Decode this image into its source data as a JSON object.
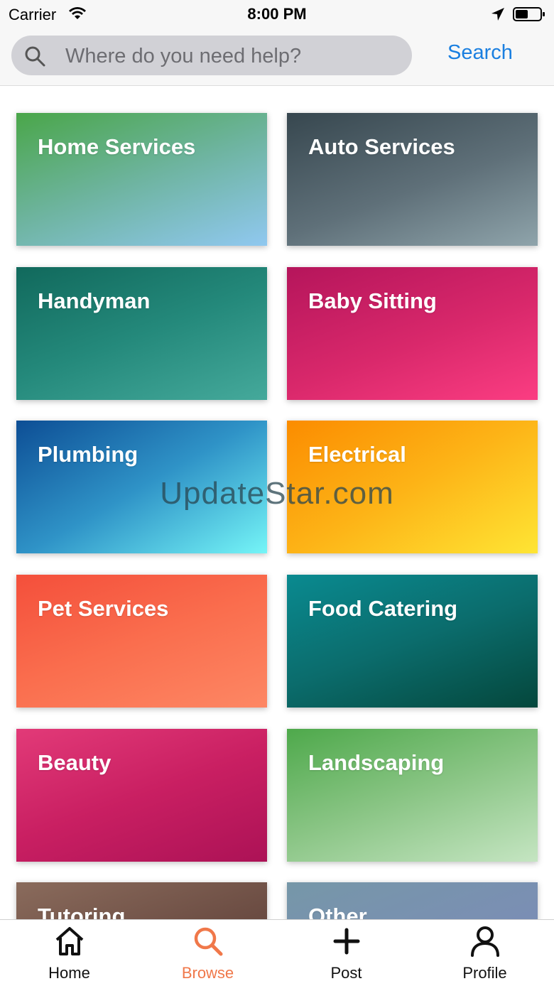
{
  "status_bar": {
    "carrier": "Carrier",
    "time": "8:00 PM",
    "icons": [
      "wifi-icon",
      "location-arrow-icon",
      "battery-icon"
    ]
  },
  "search": {
    "placeholder": "Where do you need help?",
    "value": "",
    "button_label": "Search",
    "accent_color": "#1a7fe0"
  },
  "categories": [
    {
      "label": "Home Services"
    },
    {
      "label": "Auto Services"
    },
    {
      "label": "Handyman"
    },
    {
      "label": "Baby Sitting"
    },
    {
      "label": "Plumbing"
    },
    {
      "label": "Electrical"
    },
    {
      "label": "Pet Services"
    },
    {
      "label": "Food Catering"
    },
    {
      "label": "Beauty"
    },
    {
      "label": "Landscaping"
    },
    {
      "label": "Tutoring"
    },
    {
      "label": "Other"
    }
  ],
  "watermark": "UpdateStar.com",
  "tabbar": {
    "active_color": "#f0784a",
    "tabs": [
      {
        "label": "Home",
        "icon": "home-icon",
        "active": false
      },
      {
        "label": "Browse",
        "icon": "search-icon",
        "active": true
      },
      {
        "label": "Post",
        "icon": "plus-icon",
        "active": false
      },
      {
        "label": "Profile",
        "icon": "user-icon",
        "active": false
      }
    ]
  }
}
